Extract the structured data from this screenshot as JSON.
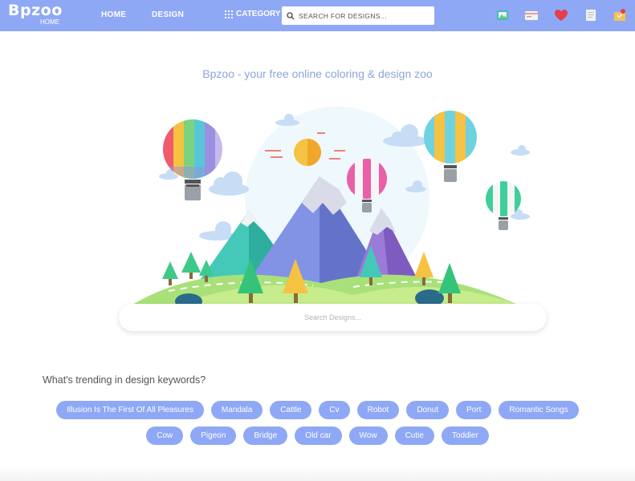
{
  "header": {
    "logo": "Bpzoo",
    "logo_sub": "HOME",
    "nav": {
      "home": "HOME",
      "design": "DESIGN",
      "category": "CATEGORY"
    },
    "search_placeholder": "SEARCH FOR DESIGNS...",
    "icons": [
      "picture-frame-icon",
      "card-icon",
      "heart-icon",
      "document-icon",
      "cart-icon"
    ]
  },
  "main": {
    "tagline": "Bpzoo - your free online coloring & design zoo",
    "search_placeholder": "Search Designs..."
  },
  "trending": {
    "title": "What's trending in design keywords?",
    "row1": [
      "Illusion Is The First Of All Pleasures",
      "Mandala",
      "Cattle",
      "Cv",
      "Robot",
      "Donut",
      "Port",
      "Romantic Songs"
    ],
    "row2": [
      "Cow",
      "Pigeon",
      "Bridge",
      "Old car",
      "Wow",
      "Cutie",
      "Toddler"
    ]
  },
  "colors": {
    "accent": "#8fa8f6",
    "tagline": "#8ca6d6"
  }
}
